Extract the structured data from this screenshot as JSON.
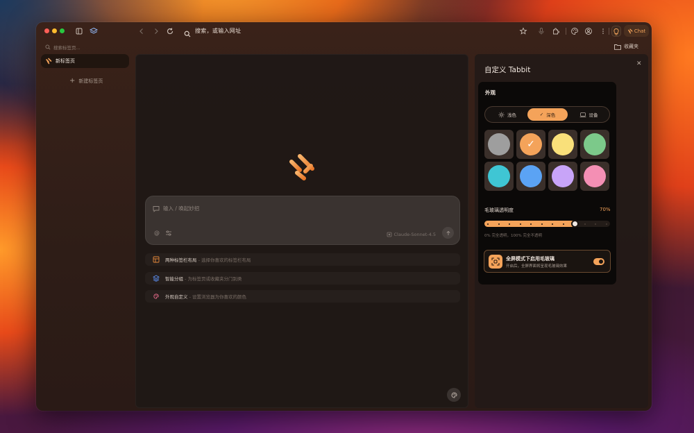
{
  "browser": {
    "address_placeholder": "搜索，或输入网址",
    "chat_label": "Chat",
    "bookmarks_label": "收藏夹"
  },
  "sidebar": {
    "search_placeholder": "搜索标签页...",
    "active_tab_label": "新标签页",
    "new_tab_label": "新建标签页"
  },
  "main": {
    "composer_placeholder": "输入 / 唤起妙招",
    "model_label": "Claude-Sonnet-4.5",
    "suggestions": [
      {
        "title": "两种标签栏布局",
        "desc": "- 选择你喜欢的标签栏布局",
        "icon": "layout-icon",
        "color": "#e8893a"
      },
      {
        "title": "智能分组",
        "desc": "- 为标签页或收藏夹分门别类",
        "icon": "layers-icon",
        "color": "#5b8ef0"
      },
      {
        "title": "外观自定义",
        "desc": "- 设置浏览器为你喜欢的颜色",
        "icon": "palette-icon",
        "color": "#e66a8a"
      }
    ]
  },
  "panel": {
    "title": "自定义 Tabbit",
    "appearance_title": "外观",
    "theme_modes": [
      "浅色",
      "深色",
      "设备"
    ],
    "selected_mode": "深色",
    "swatches": [
      "#9e9e9e",
      "#f4a35a",
      "#f9e07a",
      "#7cc98a",
      "#3fc6d4",
      "#5ba3f4",
      "#c8a4f8",
      "#f48fb4"
    ],
    "selected_swatch": 1,
    "opacity_label": "毛玻璃透明度",
    "opacity_value": "70%",
    "opacity_fraction": 0.7,
    "opacity_hint": "0% 完全透明，100% 完全不透明",
    "glass_title": "全屏模式下启用毛玻璃",
    "glass_desc": "开启后，全屏界面将呈现毛玻璃效果",
    "glass_enabled": true
  }
}
